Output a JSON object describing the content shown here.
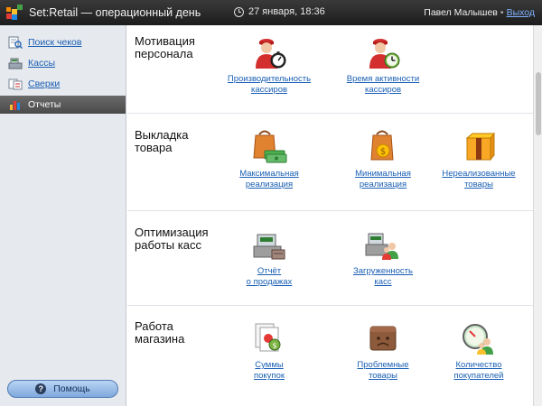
{
  "header": {
    "app_title": "Set:Retail — операционный день",
    "datetime": "27 января, 18:36",
    "user_name": "Павел Малышев",
    "separator": "•",
    "logout": "Выход"
  },
  "sidebar": {
    "items": [
      {
        "label": "Поиск чеков",
        "icon": "search-receipts-icon",
        "active": false
      },
      {
        "label": "Кассы",
        "icon": "cash-register-icon",
        "active": false
      },
      {
        "label": "Сверки",
        "icon": "reconciliation-icon",
        "active": false
      },
      {
        "label": "Отчеты",
        "icon": "reports-chart-icon",
        "active": true
      }
    ],
    "help_label": "Помощь"
  },
  "sections": [
    {
      "title": "Мотивация\nперсонала",
      "reports": [
        {
          "label": "Производительность\nкассиров",
          "icon": "cashier-stopwatch-icon"
        },
        {
          "label": "Время активности\nкассиров",
          "icon": "cashier-clock-icon"
        }
      ]
    },
    {
      "title": "Выкладка\nтовара",
      "reports": [
        {
          "label": "Максимальная\nреализация",
          "icon": "bag-money-icon"
        },
        {
          "label": "Минимальная\nреализация",
          "icon": "bag-coin-icon"
        },
        {
          "label": "Нереализованные\nтовары",
          "icon": "gift-box-icon"
        }
      ]
    },
    {
      "title": "Оптимизация\nработы касс",
      "reports": [
        {
          "label": "Отчёт\nо продажах",
          "icon": "register-sales-icon"
        },
        {
          "label": "Загруженность\nкасс",
          "icon": "register-people-icon"
        }
      ]
    },
    {
      "title": "Работа\nмагазина",
      "reports": [
        {
          "label": "Суммы\nпокупок",
          "icon": "receipts-stack-icon"
        },
        {
          "label": "Проблемные\nтовары",
          "icon": "sad-box-icon"
        },
        {
          "label": "Количество\nпокупателей",
          "icon": "customers-gauge-icon"
        }
      ]
    }
  ],
  "colors": {
    "link": "#1a5fb4",
    "topbar": "#2a2a2a",
    "sidebar": "#e6e9ee",
    "active_item": "#555555",
    "help_button": "#9dbde8"
  }
}
